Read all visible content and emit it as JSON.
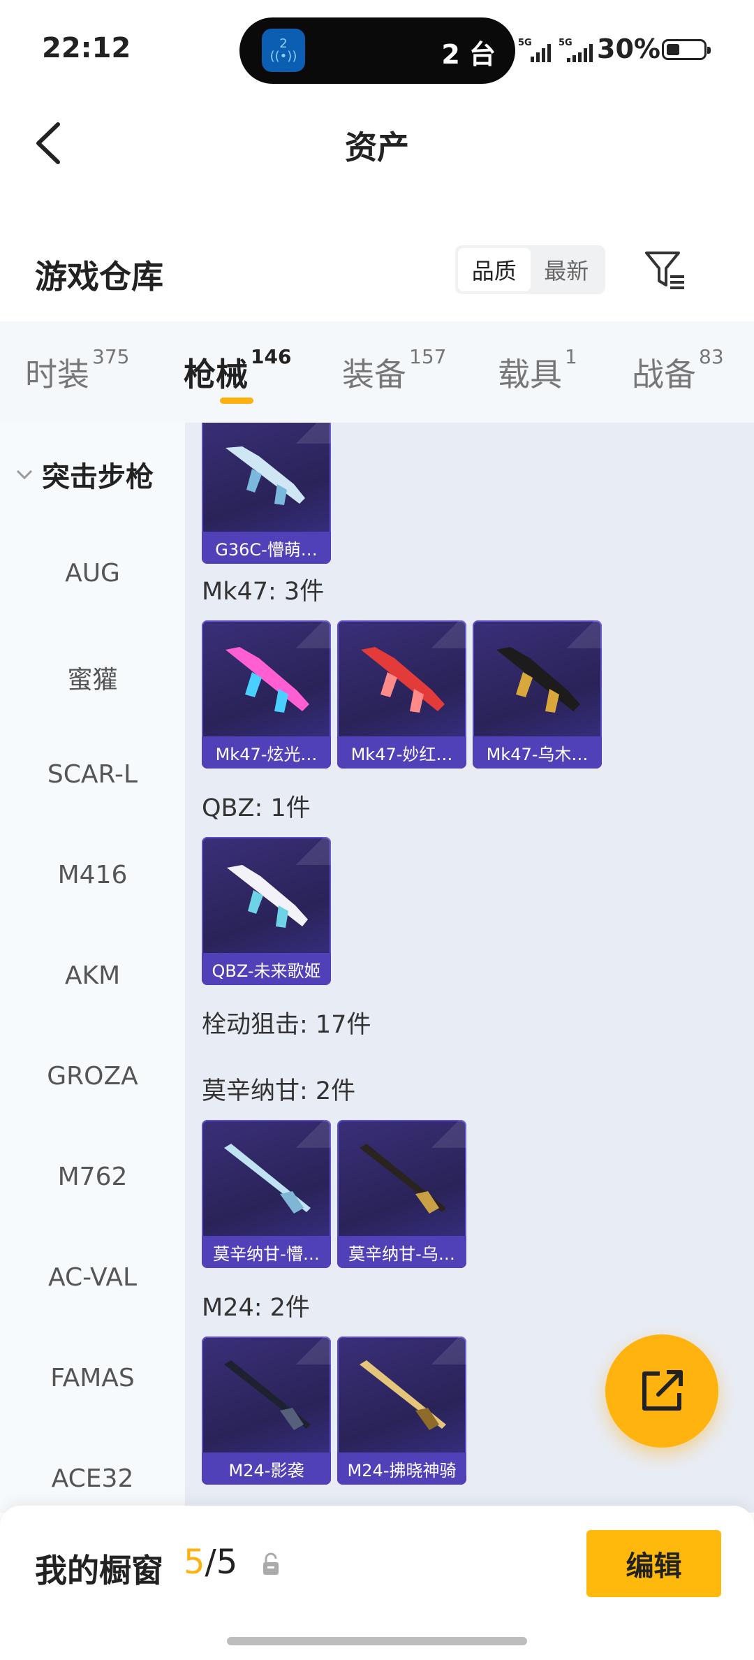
{
  "status": {
    "time": "22:12",
    "island_count": "2 台",
    "island_app_badge": "2",
    "sig1": "5G",
    "sig2": "5G",
    "battery": "30%"
  },
  "header": {
    "title": "资产"
  },
  "warehouse": {
    "title": "游戏仓库",
    "sort": [
      {
        "label": "品质",
        "active": true
      },
      {
        "label": "最新",
        "active": false
      }
    ]
  },
  "tabs": [
    {
      "label": "时装",
      "count": "375"
    },
    {
      "label": "枪械",
      "count": "146"
    },
    {
      "label": "装备",
      "count": "157"
    },
    {
      "label": "载具",
      "count": "1"
    },
    {
      "label": "战备",
      "count": "83"
    }
  ],
  "sidebar": {
    "category": "突击步枪",
    "items": [
      "AUG",
      "蜜獾",
      "SCAR-L",
      "M416",
      "AKM",
      "GROZA",
      "M762",
      "AC-VAL",
      "FAMAS",
      "ACE32"
    ]
  },
  "groups": [
    {
      "title": "",
      "items": [
        {
          "label": "G36C-懵萌…",
          "colors": [
            "#cfe6f5",
            "#7ab8de"
          ]
        }
      ]
    },
    {
      "title": "Mk47: 3件",
      "items": [
        {
          "label": "Mk47-炫光…",
          "colors": [
            "#ff5fd2",
            "#4ad0ff"
          ]
        },
        {
          "label": "Mk47-妙红…",
          "colors": [
            "#e33a3a",
            "#ff8a8a"
          ]
        },
        {
          "label": "Mk47-乌木…",
          "colors": [
            "#1d1b1b",
            "#d8a93a"
          ]
        }
      ]
    },
    {
      "title": "QBZ: 1件",
      "items": [
        {
          "label": "QBZ-未来歌姬",
          "colors": [
            "#f2f2f8",
            "#6fd3e8"
          ]
        }
      ]
    },
    {
      "title": "栓动狙击: 17件",
      "items": []
    },
    {
      "title": "莫辛纳甘: 2件",
      "items": [
        {
          "label": "莫辛纳甘-懵…",
          "colors": [
            "#bfe3f3",
            "#7fb6d6"
          ]
        },
        {
          "label": "莫辛纳甘-乌…",
          "colors": [
            "#2a2320",
            "#caa045"
          ]
        }
      ]
    },
    {
      "title": "M24: 2件",
      "items": [
        {
          "label": "M24-影袭",
          "colors": [
            "#1e2130",
            "#57607a"
          ]
        },
        {
          "label": "M24-拂晓神骑",
          "colors": [
            "#e4c57a",
            "#8e6b2a"
          ]
        }
      ]
    }
  ],
  "bottom": {
    "label": "我的橱窗",
    "current": "5",
    "sep": "/",
    "total": "5",
    "edit": "编辑"
  }
}
